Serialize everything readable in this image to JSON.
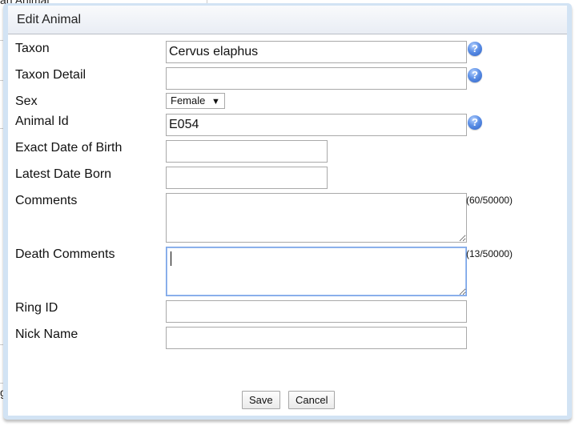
{
  "background": {
    "fragment_top": "an Animal",
    "fragment_bottom": "g"
  },
  "dialog": {
    "title": "Edit Animal",
    "fields": {
      "taxon": {
        "label": "Taxon",
        "value": "Cervus elaphus",
        "help": "?"
      },
      "taxon_detail": {
        "label": "Taxon Detail",
        "value": "",
        "help": "?"
      },
      "sex": {
        "label": "Sex",
        "selected": "Female",
        "arrow": "▼"
      },
      "animal_id": {
        "label": "Animal Id",
        "value": "E054",
        "help": "?"
      },
      "exact_dob": {
        "label": "Exact Date of Birth",
        "value": ""
      },
      "latest_date_born": {
        "label": "Latest Date Born",
        "value": ""
      },
      "comments": {
        "label": "Comments",
        "value": "",
        "counter": "(60/50000)"
      },
      "death_comments": {
        "label": "Death Comments",
        "value": "",
        "counter": "(13/50000)"
      },
      "ring_id": {
        "label": "Ring ID",
        "value": ""
      },
      "nick_name": {
        "label": "Nick Name",
        "value": ""
      }
    },
    "buttons": {
      "save": "Save",
      "cancel": "Cancel"
    }
  }
}
